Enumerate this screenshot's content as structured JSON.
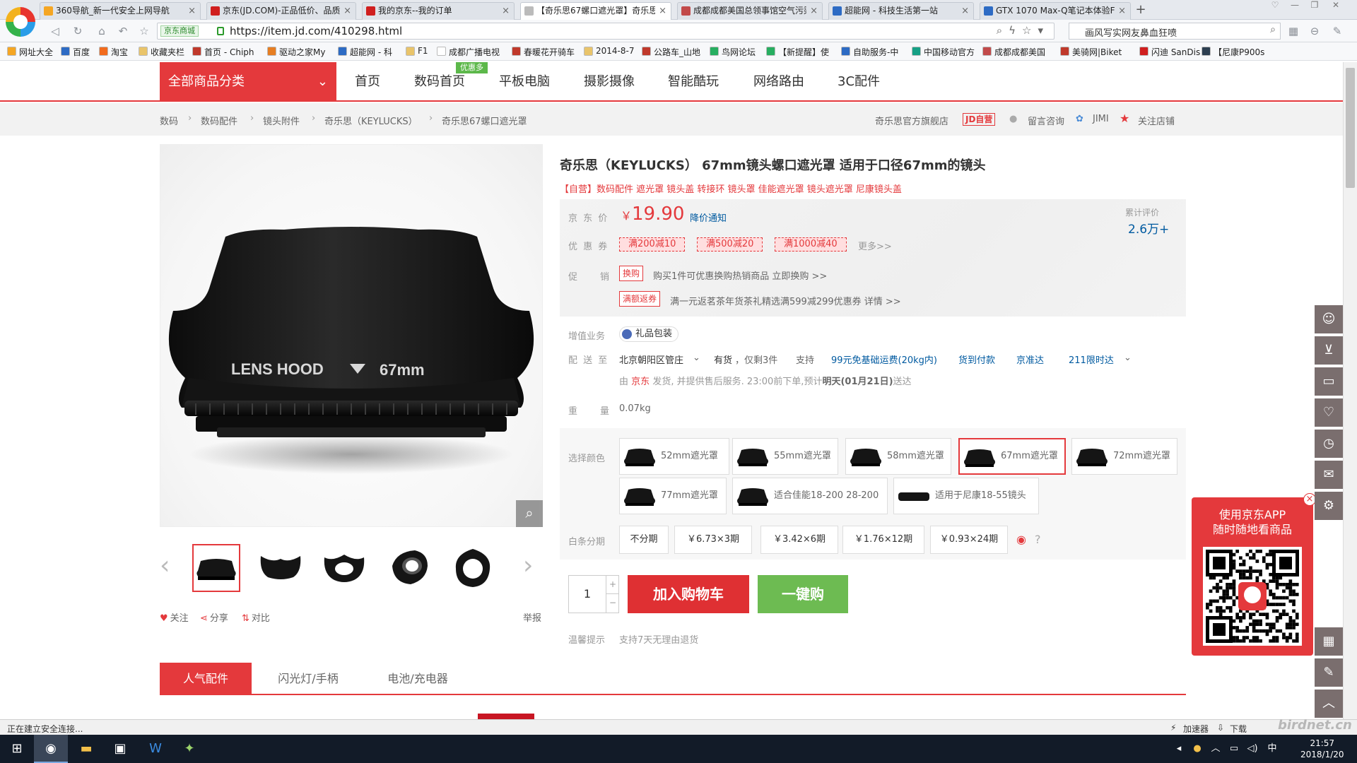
{
  "browser": {
    "tabs": [
      {
        "title": "360导航_新一代安全上网导航",
        "fav": "#f5a623"
      },
      {
        "title": "京东(JD.COM)-正品低价、品质",
        "fav": "#d01f1f"
      },
      {
        "title": "我的京东--我的订单",
        "fav": "#d01f1f"
      },
      {
        "title": "【奇乐思67螺口遮光罩】奇乐思",
        "fav": "#bbbbbb"
      },
      {
        "title": "成都成都美国总领事馆空气污染",
        "fav": "#c24a4a"
      },
      {
        "title": "超能网 - 科技生活第一站",
        "fav": "#2d6bc4"
      },
      {
        "title": "GTX 1070 Max-Q笔记本体验Fr",
        "fav": "#2d6bc4"
      }
    ],
    "new_tab": "+",
    "site_badge": "京东商城",
    "url": "https://item.jd.com/410298.html",
    "search_value": "画风写实网友鼻血狂喷",
    "bookmarks": [
      {
        "label": "网址大全",
        "color": "#f5a623"
      },
      {
        "label": "百度",
        "color": "#2d6bc4"
      },
      {
        "label": "淘宝",
        "color": "#f26b1d"
      },
      {
        "label": "收藏夹栏",
        "color": "#e9c46a"
      },
      {
        "label": "首页 - Chiph",
        "color": "#c0392b"
      },
      {
        "label": "驱动之家My",
        "color": "#e67e22"
      },
      {
        "label": "超能网 - 科",
        "color": "#2d6bc4"
      },
      {
        "label": "F1",
        "color": "#e9c46a"
      },
      {
        "label": "成都广播电视",
        "color": "#ffffff"
      },
      {
        "label": "春暖花开骑车",
        "color": "#c0392b"
      },
      {
        "label": "2014-8-7",
        "color": "#e9c46a"
      },
      {
        "label": "公路车_山地",
        "color": "#c0392b"
      },
      {
        "label": "鸟网论坛",
        "color": "#27ae60"
      },
      {
        "label": "【新提醒】使",
        "color": "#27ae60"
      },
      {
        "label": "自助服务-中",
        "color": "#2d6bc4"
      },
      {
        "label": "中国移动官方",
        "color": "#16a085"
      },
      {
        "label": "成都成都美国",
        "color": "#c24a4a"
      },
      {
        "label": "美骑网|Biket",
        "color": "#c0392b"
      },
      {
        "label": "闪迪 SanDis",
        "color": "#d01f1f"
      },
      {
        "label": "【尼康P900s",
        "color": "#2c3e50"
      }
    ]
  },
  "nav": {
    "all_categories": "全部商品分类",
    "links": [
      "首页",
      "数码首页",
      "平板电脑",
      "摄影摄像",
      "智能酷玩",
      "网络路由",
      "3C配件"
    ],
    "promo_badge": "优惠多"
  },
  "breadcrumb": {
    "items": [
      "数码",
      "数码配件",
      "镜头附件",
      "奇乐思（KEYLUCKS）",
      "奇乐思67螺口遮光罩"
    ],
    "shop_name": "奇乐思官方旗舰店",
    "self_badge": "JD自营",
    "consult": "留言咨询",
    "jimi": "JIMI",
    "follow": "关注店铺"
  },
  "gallery": {
    "hood_text": "LENS HOOD",
    "hood_size": "67mm",
    "follow": "关注",
    "share": "分享",
    "compare": "对比",
    "report": "举报"
  },
  "product": {
    "title": "奇乐思（KEYLUCKS） 67mm镜头螺口遮光罩 适用于口径67mm的镜头",
    "subtitle": "【自营】数码配件 遮光罩 镜头盖 转接环 镜头罩 佳能遮光罩 镜头遮光罩 尼康镜头盖",
    "price_label": "京 东 价",
    "currency": "￥",
    "price": "19.90",
    "price_alert": "降价通知",
    "comments_label": "累计评价",
    "comments_value": "2.6万+",
    "coupon_label": "优 惠 券",
    "coupons": [
      "满200减10",
      "满500减20",
      "满1000减40"
    ],
    "more": "更多>>",
    "promo_label": "促　　销",
    "promos": [
      {
        "tag": "换购",
        "text": "购买1件可优惠换购热销商品 立即换购 >>"
      },
      {
        "tag": "满额返券",
        "text": "满一元返茗茶年货茶礼精选满599减299优惠券 详情 >>"
      }
    ],
    "vas_label": "增值业务",
    "gift_wrap": "礼品包装",
    "delivery_label": "配 送 至",
    "delivery": [
      "北京朝阳区管庄",
      "有货",
      "，仅剩3件",
      "支持",
      "99元免基础运费(20kg内)",
      "货到付款",
      "京准达",
      "211限时达"
    ],
    "ship_prefix": "由",
    "ship_jd": "京东",
    "ship_mid": "发货, 并提供售后服务. 23:00前下单,预计",
    "ship_date": "明天(01月21日)",
    "ship_suffix": "送达",
    "weight_label": "重　　量",
    "weight": "0.07kg",
    "color_label": "选择颜色",
    "options": [
      "52mm遮光罩",
      "55mm遮光罩",
      "58mm遮光罩",
      "67mm遮光罩",
      "72mm遮光罩",
      "77mm遮光罩",
      "适合佳能18-200 28-200",
      "适用于尼康18-55镜头"
    ],
    "installment_label": "白条分期",
    "installments": [
      "不分期",
      "￥6.73×3期",
      "￥3.42×6期",
      "￥1.76×12期",
      "￥0.93×24期"
    ],
    "quantity": "1",
    "add_to_cart": "加入购物车",
    "one_click": "一键购",
    "tip_label": "温馨提示",
    "tip_text": "支持7天无理由退货"
  },
  "tabs": [
    "人气配件",
    "闪光灯/手柄",
    "电池/充电器"
  ],
  "qr": {
    "line1": "使用京东APP",
    "line2": "随时随地看商品",
    "close": "×"
  },
  "status": {
    "text": "正在建立安全连接...",
    "accelerator": "加速器",
    "download": "下载"
  },
  "clock": {
    "time": "21:57",
    "date": "2018/1/20"
  },
  "watermark": "birdnet.cn"
}
